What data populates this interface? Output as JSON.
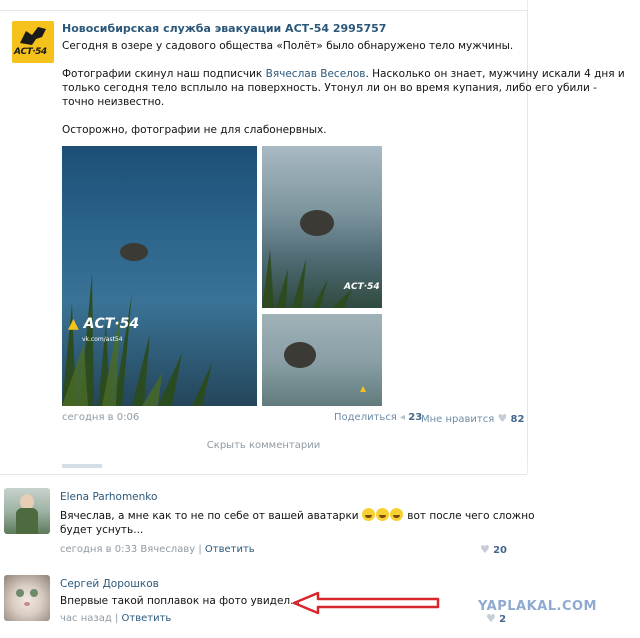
{
  "post": {
    "author": "Новосибирская служба эвакуации АСТ-54 2995757",
    "logo_text": "АСТ·54",
    "lines": [
      "Сегодня в озере у садового общества «Полёт» было обнаружено тело мужчины.",
      "Фотографии скинул наш подписчик ",
      "Вячеслав Веселов",
      ". Насколько он знает, мужчину искали 4 дня и",
      "только сегодня тело всплыло на поверхность. Утонул ли он во время купания, либо его убили -",
      "точно неизвестно.",
      "Осторожно, фотографии не для слабонервных."
    ],
    "photo_watermark": "АСТ·54",
    "photo_watermark_small": "vk.com/ast54",
    "time": "сегодня в 0:06",
    "share_label": "Поделиться",
    "share_count": "23",
    "like_label": "Мне нравится",
    "like_count": "82",
    "hide_comments": "Скрыть комментарии"
  },
  "comments": [
    {
      "name": "Elena Parhomenko",
      "text_a": "Вячеслав, а мне как то не по себе от вашей аватарки",
      "text_b": " вот после чего сложно",
      "text_c": "будет уснуть...",
      "time": "сегодня в 0:33 Вячеславу",
      "sep": "|",
      "reply": "Ответить",
      "likes": "20"
    },
    {
      "name": "Сергей Дорошков",
      "text": "Впервые такой поплавок на фото увидел...",
      "time": "час назад",
      "sep": "|",
      "reply": "Ответить",
      "likes": "2"
    }
  ],
  "watermark": "YAPLAKAL.COM",
  "colors": {
    "link": "#2b587a",
    "meta": "#8f9aa3",
    "brand_yellow": "#f4c21b",
    "arrow": "#d9262c",
    "site": "#8faad0"
  },
  "icons": [
    "share-icon",
    "heart-icon",
    "emoji-laugh-icon"
  ]
}
